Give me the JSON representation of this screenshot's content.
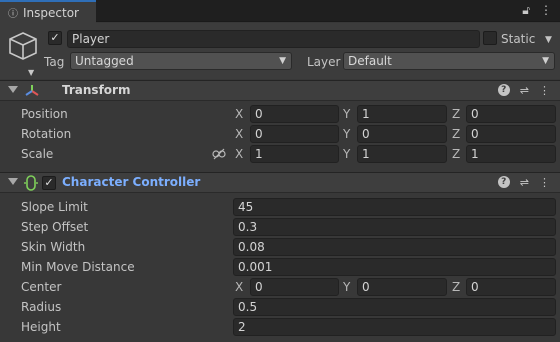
{
  "tab": {
    "title": "Inspector"
  },
  "object": {
    "name": "Player",
    "static_label": "Static",
    "tag_label": "Tag",
    "tag_value": "Untagged",
    "layer_label": "Layer",
    "layer_value": "Default"
  },
  "transform": {
    "title": "Transform",
    "rows": [
      {
        "label": "Position",
        "x": "0",
        "y": "1",
        "z": "0"
      },
      {
        "label": "Rotation",
        "x": "0",
        "y": "0",
        "z": "0"
      },
      {
        "label": "Scale",
        "x": "1",
        "y": "1",
        "z": "1"
      }
    ]
  },
  "character_controller": {
    "title": "Character Controller",
    "slope_limit": {
      "label": "Slope Limit",
      "value": "45"
    },
    "step_offset": {
      "label": "Step Offset",
      "value": "0.3"
    },
    "skin_width": {
      "label": "Skin Width",
      "value": "0.08"
    },
    "min_move_distance": {
      "label": "Min Move Distance",
      "value": "0.001"
    },
    "center": {
      "label": "Center",
      "x": "0",
      "y": "0",
      "z": "0"
    },
    "radius": {
      "label": "Radius",
      "value": "0.5"
    },
    "height": {
      "label": "Height",
      "value": "2"
    }
  },
  "axes": {
    "x": "X",
    "y": "Y",
    "z": "Z"
  },
  "colors": {
    "accent_tab": "#2f6fb8",
    "component_title_link": "#7cafff"
  }
}
